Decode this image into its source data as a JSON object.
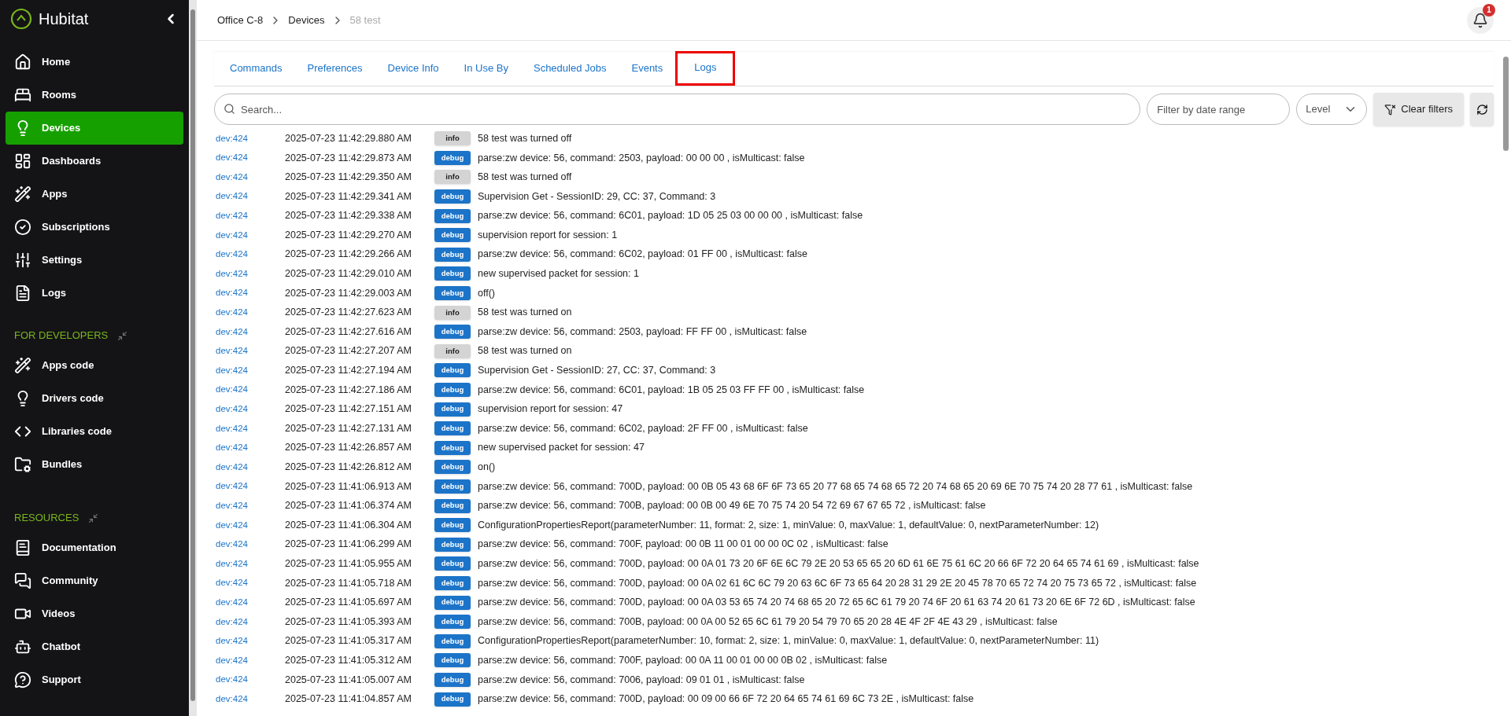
{
  "sidebar": {
    "brand": "Hubitat",
    "sections": [
      {
        "items": [
          {
            "label": "Home",
            "selected": false
          },
          {
            "label": "Rooms",
            "selected": false
          },
          {
            "label": "Devices",
            "selected": true
          },
          {
            "label": "Dashboards",
            "selected": false
          },
          {
            "label": "Apps",
            "selected": false
          },
          {
            "label": "Subscriptions",
            "selected": false
          },
          {
            "label": "Settings",
            "selected": false
          },
          {
            "label": "Logs",
            "selected": false
          }
        ]
      },
      {
        "title": "FOR DEVELOPERS",
        "items": [
          {
            "label": "Apps code",
            "selected": false
          },
          {
            "label": "Drivers code",
            "selected": false
          },
          {
            "label": "Libraries code",
            "selected": false
          },
          {
            "label": "Bundles",
            "selected": false
          }
        ]
      },
      {
        "title": "RESOURCES",
        "items": [
          {
            "label": "Documentation",
            "selected": false
          },
          {
            "label": "Community",
            "selected": false
          },
          {
            "label": "Videos",
            "selected": false
          },
          {
            "label": "Chatbot",
            "selected": false
          },
          {
            "label": "Support",
            "selected": false
          }
        ]
      }
    ]
  },
  "breadcrumb": [
    "Office C-8",
    "Devices",
    "58 test"
  ],
  "notifications": {
    "count": "1"
  },
  "tabs": [
    {
      "label": "Commands",
      "selected": false
    },
    {
      "label": "Preferences",
      "selected": false
    },
    {
      "label": "Device Info",
      "selected": false
    },
    {
      "label": "In Use By",
      "selected": false
    },
    {
      "label": "Scheduled Jobs",
      "selected": false
    },
    {
      "label": "Events",
      "selected": false
    },
    {
      "label": "Logs",
      "selected": true
    }
  ],
  "filters": {
    "search_placeholder": "Search...",
    "date_placeholder": "Filter by date range",
    "level_placeholder": "Level",
    "clear_button": "Clear filters"
  },
  "logs": [
    {
      "source": "dev:424",
      "time": "2025-07-23 11:42:29.880 AM",
      "severity": "info",
      "message": "58 test was turned off"
    },
    {
      "source": "dev:424",
      "time": "2025-07-23 11:42:29.873 AM",
      "severity": "debug",
      "message": "parse:zw device: 56, command: 2503, payload: 00 00 00 , isMulticast: false"
    },
    {
      "source": "dev:424",
      "time": "2025-07-23 11:42:29.350 AM",
      "severity": "info",
      "message": "58 test was turned off"
    },
    {
      "source": "dev:424",
      "time": "2025-07-23 11:42:29.341 AM",
      "severity": "debug",
      "message": "Supervision Get - SessionID: 29, CC: 37, Command: 3"
    },
    {
      "source": "dev:424",
      "time": "2025-07-23 11:42:29.338 AM",
      "severity": "debug",
      "message": "parse:zw device: 56, command: 6C01, payload: 1D 05 25 03 00 00 00 , isMulticast: false"
    },
    {
      "source": "dev:424",
      "time": "2025-07-23 11:42:29.270 AM",
      "severity": "debug",
      "message": "supervision report for session: 1"
    },
    {
      "source": "dev:424",
      "time": "2025-07-23 11:42:29.266 AM",
      "severity": "debug",
      "message": "parse:zw device: 56, command: 6C02, payload: 01 FF 00 , isMulticast: false"
    },
    {
      "source": "dev:424",
      "time": "2025-07-23 11:42:29.010 AM",
      "severity": "debug",
      "message": "new supervised packet for session: 1"
    },
    {
      "source": "dev:424",
      "time": "2025-07-23 11:42:29.003 AM",
      "severity": "debug",
      "message": "off()"
    },
    {
      "source": "dev:424",
      "time": "2025-07-23 11:42:27.623 AM",
      "severity": "info",
      "message": "58 test was turned on"
    },
    {
      "source": "dev:424",
      "time": "2025-07-23 11:42:27.616 AM",
      "severity": "debug",
      "message": "parse:zw device: 56, command: 2503, payload: FF FF 00 , isMulticast: false"
    },
    {
      "source": "dev:424",
      "time": "2025-07-23 11:42:27.207 AM",
      "severity": "info",
      "message": "58 test was turned on"
    },
    {
      "source": "dev:424",
      "time": "2025-07-23 11:42:27.194 AM",
      "severity": "debug",
      "message": "Supervision Get - SessionID: 27, CC: 37, Command: 3"
    },
    {
      "source": "dev:424",
      "time": "2025-07-23 11:42:27.186 AM",
      "severity": "debug",
      "message": "parse:zw device: 56, command: 6C01, payload: 1B 05 25 03 FF FF 00 , isMulticast: false"
    },
    {
      "source": "dev:424",
      "time": "2025-07-23 11:42:27.151 AM",
      "severity": "debug",
      "message": "supervision report for session: 47"
    },
    {
      "source": "dev:424",
      "time": "2025-07-23 11:42:27.131 AM",
      "severity": "debug",
      "message": "parse:zw device: 56, command: 6C02, payload: 2F FF 00 , isMulticast: false"
    },
    {
      "source": "dev:424",
      "time": "2025-07-23 11:42:26.857 AM",
      "severity": "debug",
      "message": "new supervised packet for session: 47"
    },
    {
      "source": "dev:424",
      "time": "2025-07-23 11:42:26.812 AM",
      "severity": "debug",
      "message": "on()"
    },
    {
      "source": "dev:424",
      "time": "2025-07-23 11:41:06.913 AM",
      "severity": "debug",
      "message": "parse:zw device: 56, command: 700D, payload: 00 0B 05 43 68 6F 6F 73 65 20 77 68 65 74 68 65 72 20 74 68 65 20 69 6E 70 75 74 20 28 77 61 , isMulticast: false"
    },
    {
      "source": "dev:424",
      "time": "2025-07-23 11:41:06.374 AM",
      "severity": "debug",
      "message": "parse:zw device: 56, command: 700B, payload: 00 0B 00 49 6E 70 75 74 20 54 72 69 67 67 65 72 , isMulticast: false"
    },
    {
      "source": "dev:424",
      "time": "2025-07-23 11:41:06.304 AM",
      "severity": "debug",
      "message": "ConfigurationPropertiesReport(parameterNumber: 11, format: 2, size: 1, minValue: 0, maxValue: 1, defaultValue: 0, nextParameterNumber: 12)"
    },
    {
      "source": "dev:424",
      "time": "2025-07-23 11:41:06.299 AM",
      "severity": "debug",
      "message": "parse:zw device: 56, command: 700F, payload: 00 0B 11 00 01 00 00 0C 02 , isMulticast: false"
    },
    {
      "source": "dev:424",
      "time": "2025-07-23 11:41:05.955 AM",
      "severity": "debug",
      "message": "parse:zw device: 56, command: 700D, payload: 00 0A 01 73 20 6F 6E 6C 79 2E 20 53 65 65 20 6D 61 6E 75 61 6C 20 66 6F 72 20 64 65 74 61 69 , isMulticast: false"
    },
    {
      "source": "dev:424",
      "time": "2025-07-23 11:41:05.718 AM",
      "severity": "debug",
      "message": "parse:zw device: 56, command: 700D, payload: 00 0A 02 61 6C 6C 79 20 63 6C 6F 73 65 64 20 28 31 29 2E 20 45 78 70 65 72 74 20 75 73 65 72 , isMulticast: false"
    },
    {
      "source": "dev:424",
      "time": "2025-07-23 11:41:05.697 AM",
      "severity": "debug",
      "message": "parse:zw device: 56, command: 700D, payload: 00 0A 03 53 65 74 20 74 68 65 20 72 65 6C 61 79 20 74 6F 20 61 63 74 20 61 73 20 6E 6F 72 6D , isMulticast: false"
    },
    {
      "source": "dev:424",
      "time": "2025-07-23 11:41:05.393 AM",
      "severity": "debug",
      "message": "parse:zw device: 56, command: 700B, payload: 00 0A 00 52 65 6C 61 79 20 54 79 70 65 20 28 4E 4F 2F 4E 43 29 , isMulticast: false"
    },
    {
      "source": "dev:424",
      "time": "2025-07-23 11:41:05.317 AM",
      "severity": "debug",
      "message": "ConfigurationPropertiesReport(parameterNumber: 10, format: 2, size: 1, minValue: 0, maxValue: 1, defaultValue: 0, nextParameterNumber: 11)"
    },
    {
      "source": "dev:424",
      "time": "2025-07-23 11:41:05.312 AM",
      "severity": "debug",
      "message": "parse:zw device: 56, command: 700F, payload: 00 0A 11 00 01 00 00 0B 02 , isMulticast: false"
    },
    {
      "source": "dev:424",
      "time": "2025-07-23 11:41:05.007 AM",
      "severity": "debug",
      "message": "parse:zw device: 56, command: 7006, payload: 09 01 01 , isMulticast: false"
    },
    {
      "source": "dev:424",
      "time": "2025-07-23 11:41:04.857 AM",
      "severity": "debug",
      "message": "parse:zw device: 56, command: 700D, payload: 00 09 00 66 6F 72 20 64 65 74 61 69 6C 73 2E , isMulticast: false"
    }
  ]
}
